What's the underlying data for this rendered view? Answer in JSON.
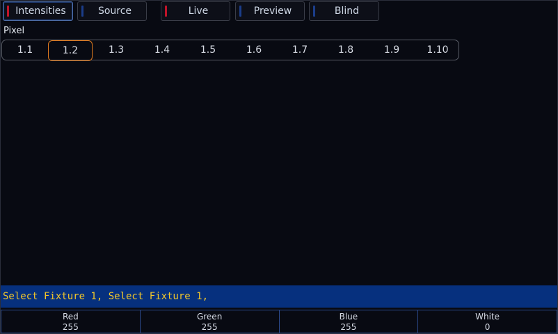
{
  "tabs": [
    {
      "label": "Intensities",
      "mark_color": "#c0142a",
      "active": true
    },
    {
      "label": "Source",
      "mark_color": "#1b3d8a",
      "active": false
    },
    {
      "label": "Live",
      "mark_color": "#c0142a",
      "active": false
    },
    {
      "label": "Preview",
      "mark_color": "#1b3d8a",
      "active": false
    },
    {
      "label": "Blind",
      "mark_color": "#1b3d8a",
      "active": false
    }
  ],
  "pixel_section": {
    "label": "Pixel",
    "items": [
      "1.1",
      "1.2",
      "1.3",
      "1.4",
      "1.5",
      "1.6",
      "1.7",
      "1.8",
      "1.9",
      "1.10"
    ],
    "selected": "1.2"
  },
  "command_line": "Select Fixture 1, Select Fixture 1,",
  "parameters": [
    {
      "name": "Red",
      "value": "255"
    },
    {
      "name": "Green",
      "value": "255"
    },
    {
      "name": "Blue",
      "value": "255"
    },
    {
      "name": "White",
      "value": "0"
    }
  ],
  "colors": {
    "background": "#080a12",
    "command_bar": "#06307e",
    "command_text": "#f2c72a",
    "selection_outline": "#e07b1e"
  }
}
